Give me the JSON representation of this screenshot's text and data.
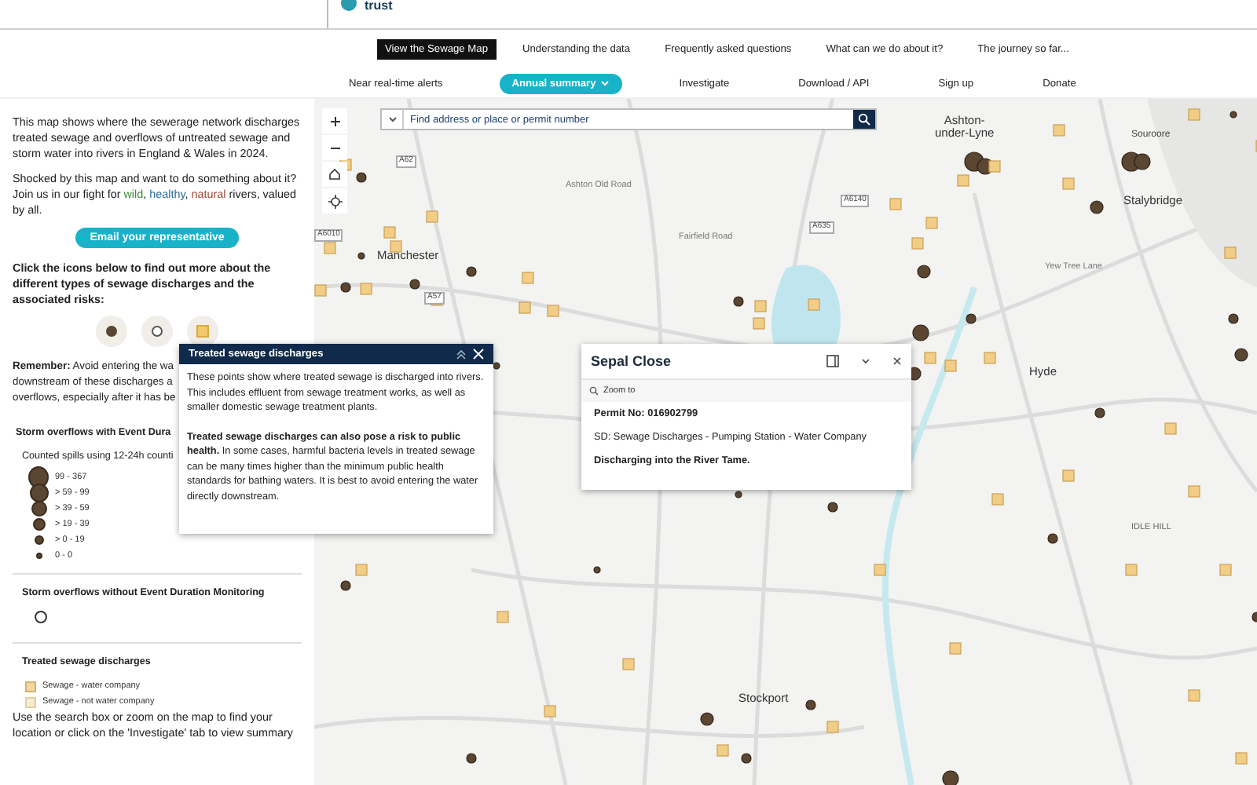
{
  "header": {
    "logo_text": "trust"
  },
  "main_nav": [
    {
      "label": "View the Sewage Map",
      "selected": true
    },
    {
      "label": "Understanding the data",
      "selected": false
    },
    {
      "label": "Frequently asked questions",
      "selected": false
    },
    {
      "label": "What can we do about it?",
      "selected": false
    },
    {
      "label": "The journey so far...",
      "selected": false
    }
  ],
  "sub_nav": [
    {
      "label": "Near real-time alerts",
      "selected": false,
      "has_menu": false
    },
    {
      "label": "Annual summary",
      "selected": true,
      "has_menu": true
    },
    {
      "label": "Investigate",
      "selected": false,
      "has_menu": false
    },
    {
      "label": "Download / API",
      "selected": false,
      "has_menu": false
    },
    {
      "label": "Sign up",
      "selected": false,
      "has_menu": false
    },
    {
      "label": "Donate",
      "selected": false,
      "has_menu": false
    }
  ],
  "sidebar": {
    "intro": "This map shows where the sewerage network discharges treated sewage and overflows of untreated sewage and storm water into rivers in England & Wales in 2024.",
    "call_to_action": [
      {
        "text": "Shocked by this map and want to do something about it? Join us in our fight for "
      },
      {
        "text": "wild",
        "color": "#3f8a3a"
      },
      {
        "text": ", "
      },
      {
        "text": "healthy",
        "color": "#2a6f97"
      },
      {
        "text": ", "
      },
      {
        "text": "natural",
        "color": "#9c4a37"
      },
      {
        "text": " rivers, valued by all."
      }
    ],
    "email_button": "Email your representative",
    "icons_prompt": "Click the icons below to find out more about the different types of sewage discharges and the associated risks:",
    "type_icons": [
      {
        "kind": "storm-edm"
      },
      {
        "kind": "storm-no-edm"
      },
      {
        "kind": "treated"
      }
    ],
    "remember_lines": [
      "**Remember:** Avoid entering the wa",
      "downstream of these discharges a",
      "overflows, especially after it has be"
    ],
    "storm_edm": {
      "title": "Storm overflows with Event Dura",
      "subtitle": "Counted spills using 12-24h counti",
      "classes": [
        {
          "label": "99 - 367"
        },
        {
          "label": "> 59 - 99"
        },
        {
          "label": "> 39 - 59"
        },
        {
          "label": "> 19 - 39"
        },
        {
          "label": "> 0 - 19"
        },
        {
          "label": "0 - 0"
        }
      ]
    },
    "storm_no_edm": {
      "title": "Storm overflows without Event Duration Monitoring"
    },
    "treated": {
      "title": "Treated sewage discharges",
      "items": [
        {
          "label": "Sewage - water company",
          "kind": "water-company"
        },
        {
          "label": "Sewage - not water company",
          "kind": "other"
        }
      ]
    },
    "footer_text": "Use the search box or zoom on the map to find your location or click on the 'Investigate' tab to view summary"
  },
  "map": {
    "search": {
      "placeholder": "Find address or place or permit number"
    },
    "place_labels": [
      {
        "text": "Manchester",
        "kind": "town"
      },
      {
        "text": "Ashton-\nunder-Lyne",
        "kind": "town"
      },
      {
        "text": "Stalybridge",
        "kind": "town"
      },
      {
        "text": "Hyde",
        "kind": "town"
      },
      {
        "text": "Stockport",
        "kind": "town"
      },
      {
        "text": "Souroore",
        "kind": "village"
      },
      {
        "text": "IDLE HILL",
        "kind": "hill"
      },
      {
        "text": "A62",
        "kind": "road"
      },
      {
        "text": "A6010",
        "kind": "road"
      },
      {
        "text": "A57",
        "kind": "road"
      },
      {
        "text": "A6140",
        "kind": "road"
      },
      {
        "text": "A635",
        "kind": "road"
      },
      {
        "text": "Fairfield Road",
        "kind": "street"
      },
      {
        "text": "Ashton Old Road",
        "kind": "street"
      },
      {
        "text": "Yew Tree Lane",
        "kind": "street"
      }
    ]
  },
  "info_panel": {
    "title": "Treated sewage discharges",
    "paragraphs": [
      "These points show where treated sewage is discharged into rivers. This includes effluent from sewage treatment works, as well as smaller domestic sewage treatment plants.",
      "**Treated sewage discharges can also pose a risk to public health.** In some cases, harmful bacteria levels in treated sewage can be many times higher than the minimum public health standards for bathing waters. It is best to avoid entering the water directly downstream."
    ]
  },
  "popup": {
    "title": "Sepal Close",
    "action": "Zoom to",
    "fields": [
      {
        "text": "Permit No: 016902799",
        "emphasis": true
      },
      {
        "text": "SD:  Sewage Discharges - Pumping Station - Water Company",
        "emphasis": false
      },
      {
        "text": "Discharging into the River Tame.",
        "emphasis": true
      }
    ]
  }
}
